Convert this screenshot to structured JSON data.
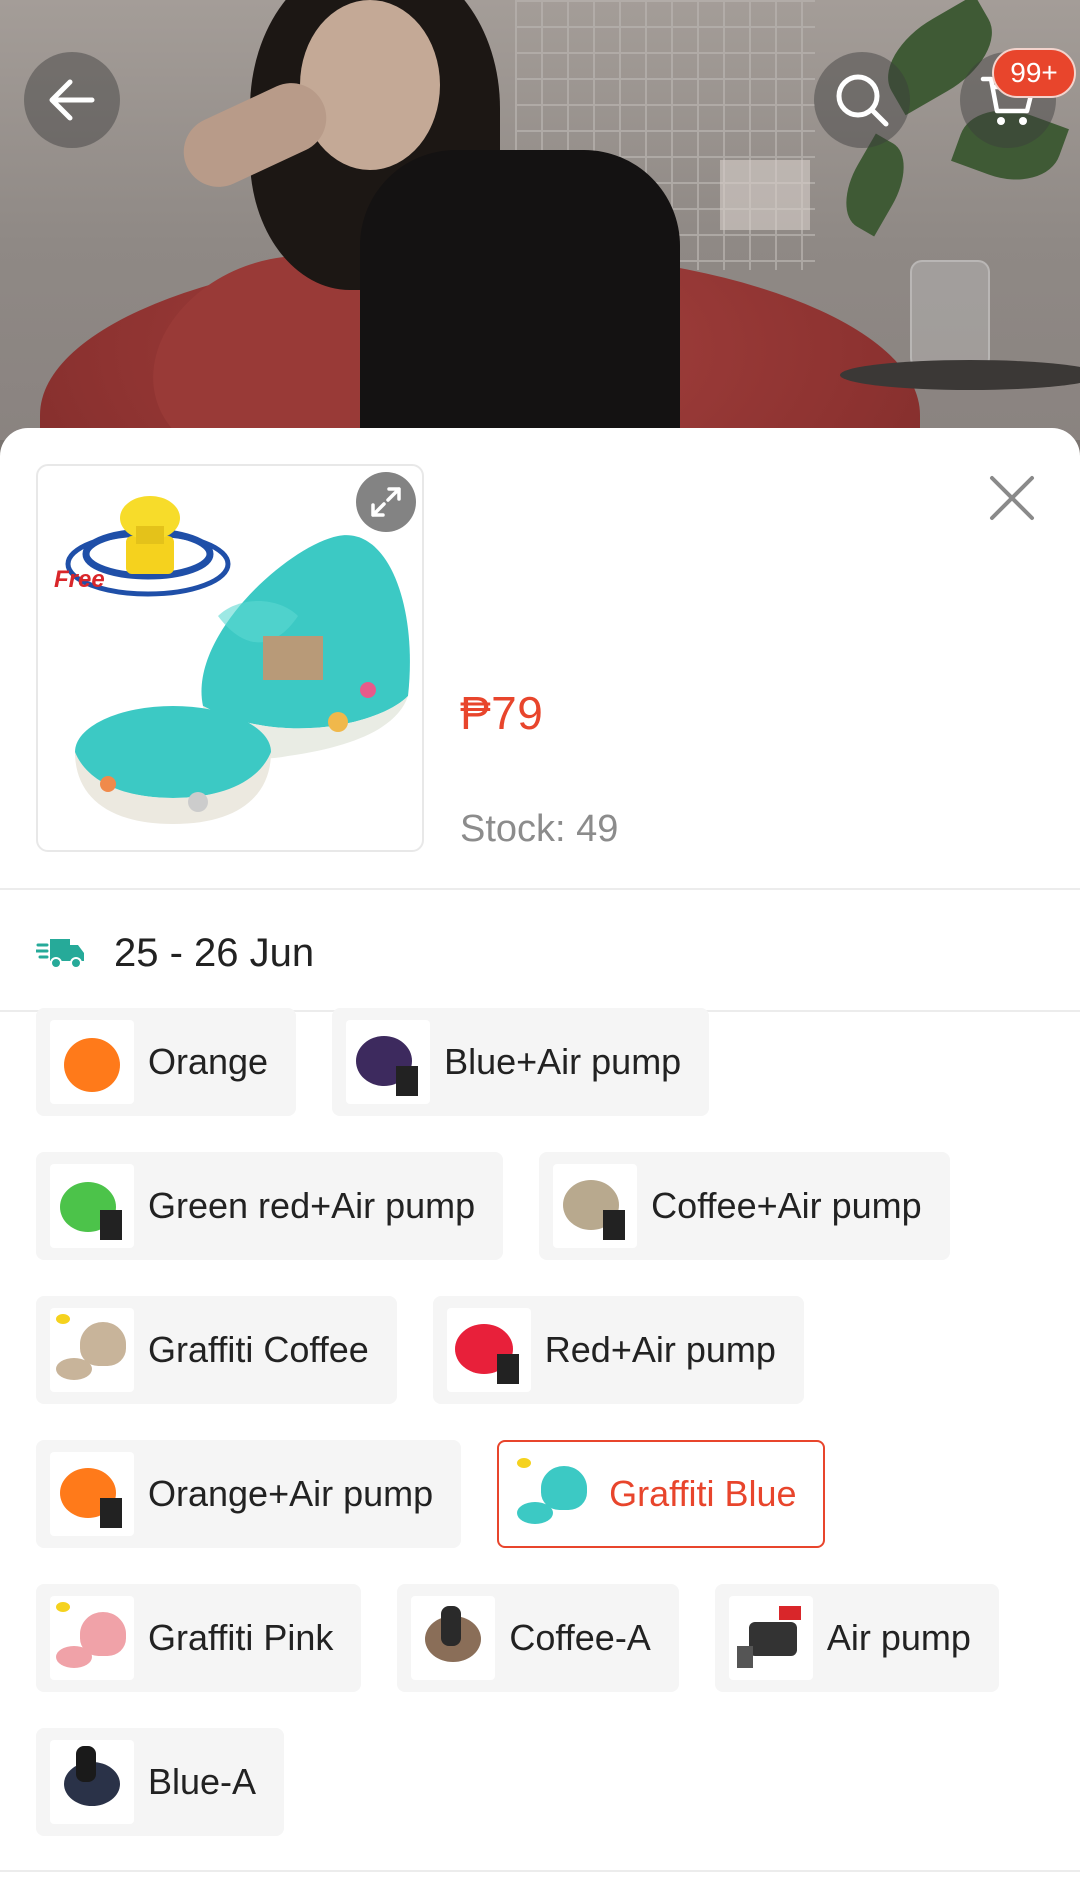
{
  "header": {
    "cart_badge": "99+",
    "back_icon": "arrow-left-icon",
    "search_icon": "search-icon",
    "cart_icon": "cart-icon"
  },
  "product": {
    "thumb_badge": "Free",
    "price": "₱79",
    "stock": "Stock: 49"
  },
  "delivery": {
    "icon": "delivery-truck-icon",
    "date": "25 - 26 Jun"
  },
  "variations": [
    {
      "label": "Orange",
      "color": "#ff7a1a"
    },
    {
      "label": "Blue+Air pump",
      "color": "#3d2a5e"
    },
    {
      "label": "Green red+Air pump",
      "color": "#4cc34a"
    },
    {
      "label": "Coffee+Air pump",
      "color": "#b8a98e"
    },
    {
      "label": "Graffiti Coffee",
      "color": "#c8b49a"
    },
    {
      "label": "Red+Air pump",
      "color": "#e8203a"
    },
    {
      "label": "Orange+Air pump",
      "color": "#ff7a1a"
    },
    {
      "label": "Graffiti Blue",
      "color": "#3cc9c4",
      "selected": true
    },
    {
      "label": "Graffiti Pink",
      "color": "#f0a2a8"
    },
    {
      "label": "Coffee-A",
      "color": "#8a6e58"
    },
    {
      "label": "Air pump",
      "color": "#333333"
    },
    {
      "label": "Blue-A",
      "color": "#2a3248"
    }
  ],
  "colors": {
    "accent": "#e8452c",
    "delivery_icon": "#26aa99"
  }
}
